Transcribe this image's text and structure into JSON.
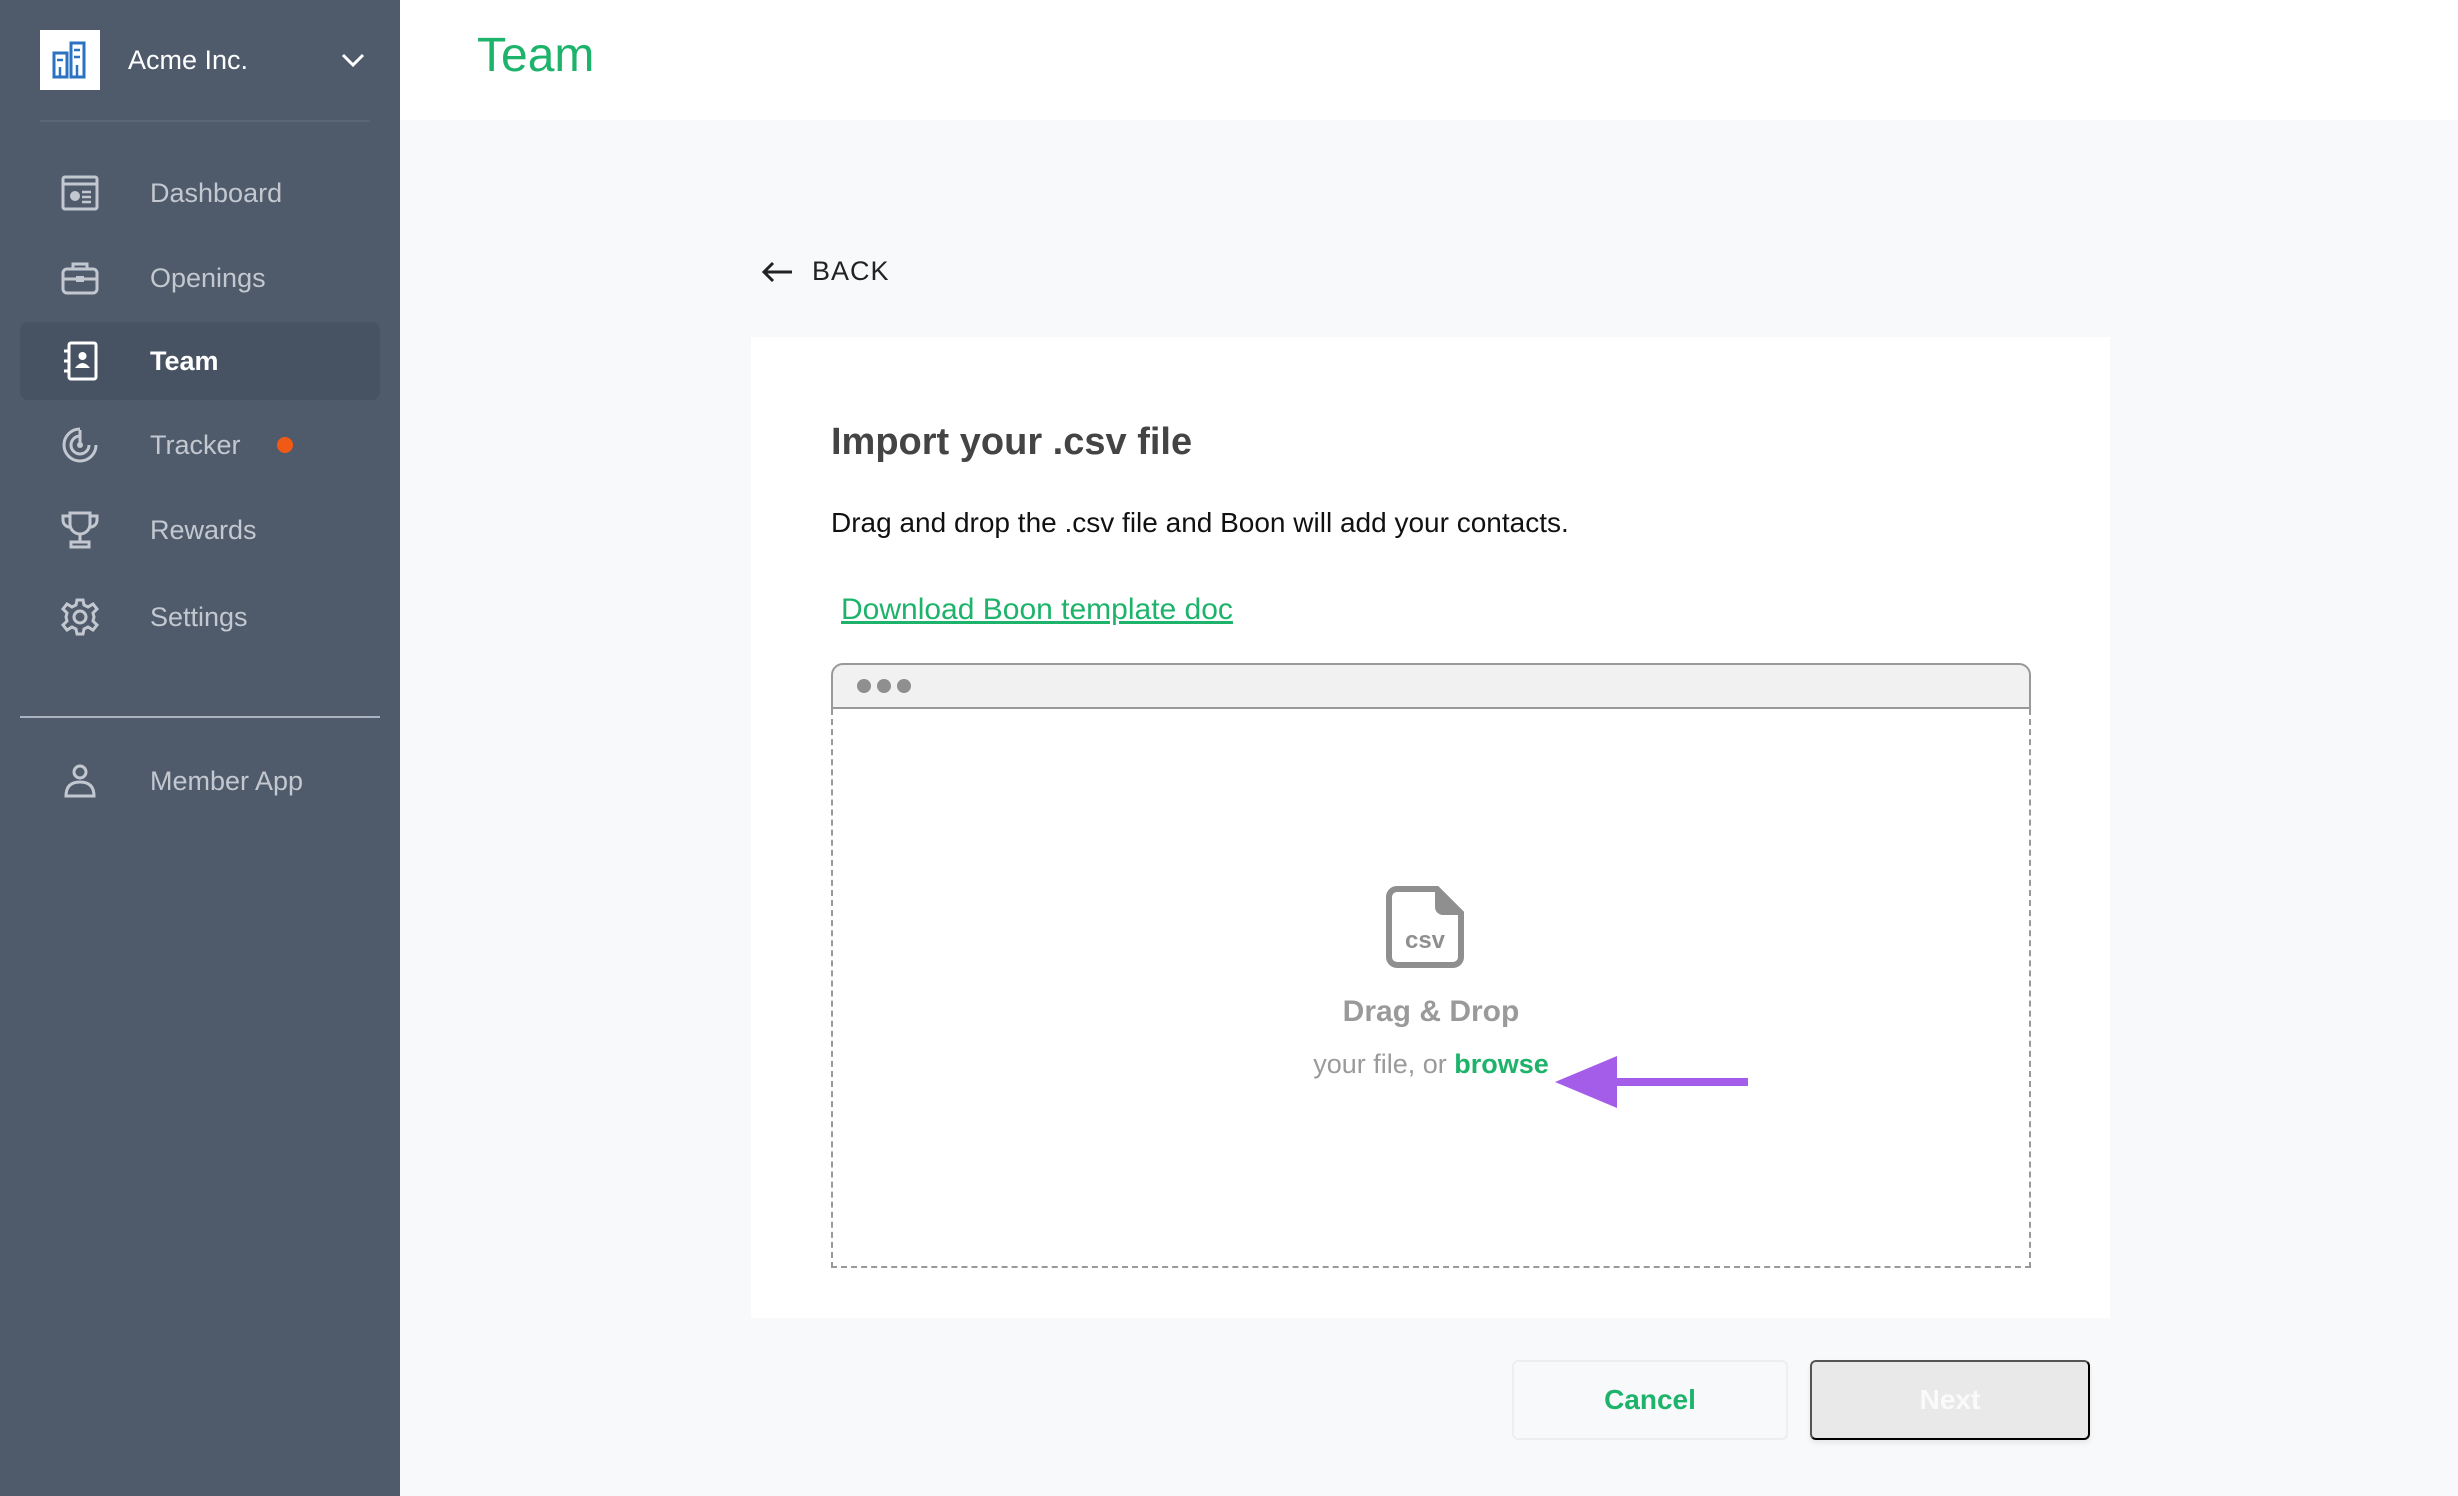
{
  "org": {
    "name": "Acme Inc.",
    "logo_icon": "buildings-icon",
    "dropdown_icon": "chevron-down-icon"
  },
  "sidebar": {
    "items": [
      {
        "label": "Dashboard",
        "icon": "dashboard-icon",
        "active": false
      },
      {
        "label": "Openings",
        "icon": "briefcase-icon",
        "active": false
      },
      {
        "label": "Team",
        "icon": "contact-book-icon",
        "active": true
      },
      {
        "label": "Tracker",
        "icon": "radar-icon",
        "active": false,
        "badge": "notification-dot"
      },
      {
        "label": "Rewards",
        "icon": "trophy-icon",
        "active": false
      },
      {
        "label": "Settings",
        "icon": "gear-icon",
        "active": false
      }
    ],
    "footer_items": [
      {
        "label": "Member App",
        "icon": "user-icon"
      }
    ]
  },
  "header": {
    "title": "Team"
  },
  "back": {
    "label": "BACK",
    "icon": "arrow-left-icon"
  },
  "card": {
    "title": "Import your .csv file",
    "description": "Drag and drop the .csv file and Boon will add your contacts.",
    "link": "Download Boon template doc",
    "dropzone": {
      "file_icon_text": "csv",
      "title": "Drag & Drop",
      "subtitle_prefix": "your file, or ",
      "browse": "browse"
    }
  },
  "annotation": {
    "arrow_color": "#a45de8",
    "points_to": "browse"
  },
  "actions": {
    "cancel": "Cancel",
    "next": "Next",
    "next_disabled": true
  },
  "colors": {
    "brand_green": "#1db36b",
    "sidebar_bg": "#4f5b6b",
    "alert_dot": "#f05a14"
  }
}
